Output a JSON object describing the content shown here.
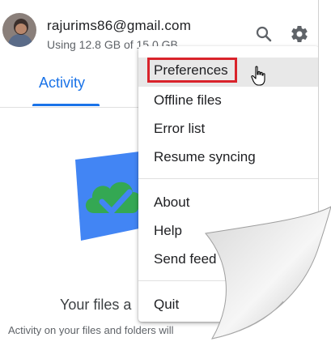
{
  "account": {
    "email": "rajurims86@gmail.com",
    "usage": "Using 12.8 GB of 15.0 GB"
  },
  "header_icons": [
    "search-icon",
    "gear-icon"
  ],
  "tabs": {
    "active": "Activity"
  },
  "empty_state": {
    "title": "Your files a",
    "subtitle": "Activity on your files and folders will"
  },
  "menu": {
    "items": [
      {
        "label": "Preferences"
      },
      {
        "label": "Offline files"
      },
      {
        "label": "Error list"
      },
      {
        "label": "Resume syncing"
      },
      {
        "label": "About"
      },
      {
        "label": "Help"
      },
      {
        "label": "Send feed"
      },
      {
        "label": "Quit"
      }
    ]
  },
  "colors": {
    "accent_blue": "#1a73e8",
    "highlight_red": "#d9232b",
    "cloud_green": "#34a853",
    "illustration_blue": "#4285f4"
  }
}
